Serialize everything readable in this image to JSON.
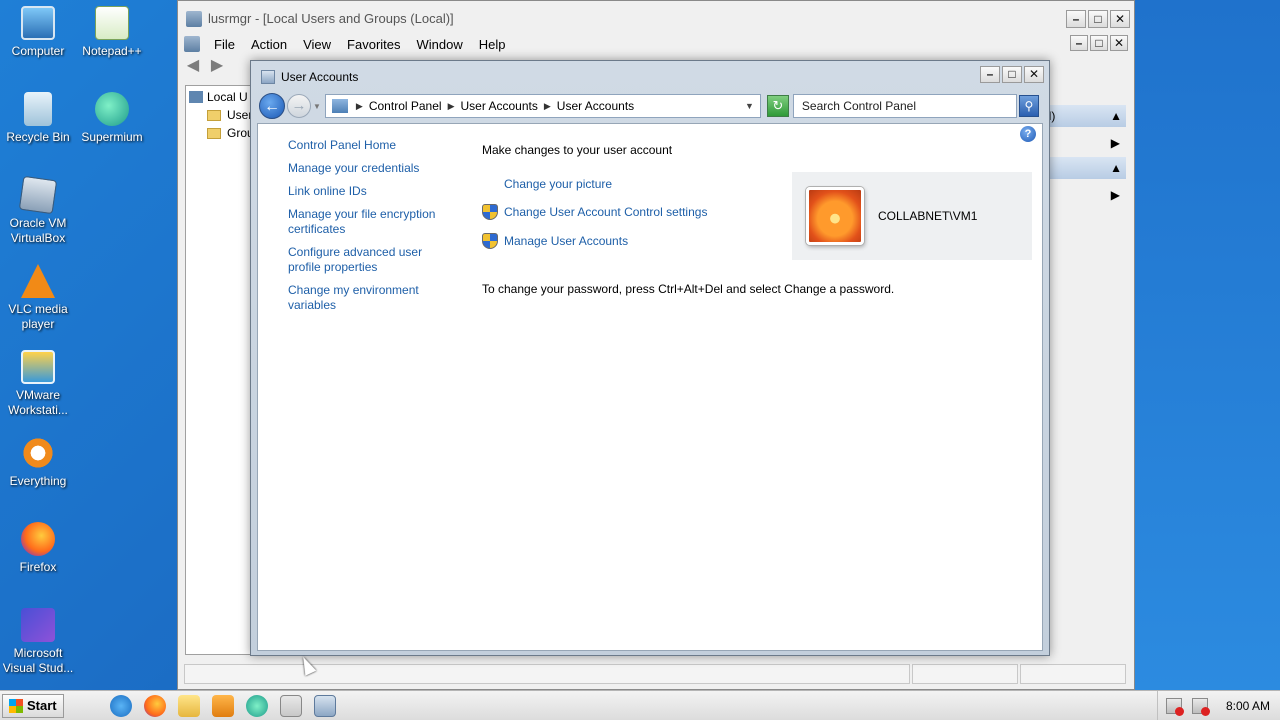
{
  "desktop": {
    "icons": [
      {
        "label": "Computer",
        "icon": "computer-icon"
      },
      {
        "label": "Notepad++",
        "icon": "notepadpp-icon"
      },
      {
        "label": "Recycle Bin",
        "icon": "recycle-bin-icon"
      },
      {
        "label": "Supermium",
        "icon": "supermium-icon"
      },
      {
        "label": "Oracle VM VirtualBox",
        "icon": "virtualbox-icon"
      },
      {
        "label": "VLC media player",
        "icon": "vlc-icon"
      },
      {
        "label": "VMware Workstati...",
        "icon": "vmware-icon"
      },
      {
        "label": "Everything",
        "icon": "everything-icon"
      },
      {
        "label": "Firefox",
        "icon": "firefox-icon"
      },
      {
        "label": "Microsoft Visual Stud...",
        "icon": "visual-studio-icon"
      }
    ]
  },
  "mmc": {
    "title": "lusrmgr - [Local Users and Groups (Local)]",
    "menu": [
      "File",
      "Action",
      "View",
      "Favorites",
      "Window",
      "Help"
    ],
    "tree": {
      "root": "Local U",
      "items": [
        "User",
        "Grou"
      ]
    },
    "actions_header_1": "al)",
    "controls": {
      "minimize": "–",
      "maximize": "□",
      "close": "✕"
    }
  },
  "user_accounts": {
    "title": "User Accounts",
    "breadcrumb": [
      "Control Panel",
      "User Accounts",
      "User Accounts"
    ],
    "search_placeholder": "Search Control Panel",
    "left_nav": {
      "home": "Control Panel Home",
      "links": [
        "Manage your credentials",
        "Link online IDs",
        "Manage your file encryption certificates",
        "Configure advanced user profile properties",
        "Change my environment variables"
      ]
    },
    "main": {
      "heading": "Make changes to your user account",
      "tasks": [
        {
          "label": "Change your picture",
          "shield": false
        },
        {
          "label": "Change User Account Control settings",
          "shield": true
        },
        {
          "label": "Manage User Accounts",
          "shield": true
        }
      ],
      "user_name": "COLLABNET\\VM1",
      "password_note": "To change your password, press Ctrl+Alt+Del and select Change a password."
    }
  },
  "taskbar": {
    "start_label": "Start",
    "pinned": [
      "internet-explorer-icon",
      "firefox-icon",
      "folder-icon",
      "media-player-icon",
      "supermium-icon",
      "lusrmgr-icon",
      "user-accounts-icon"
    ],
    "clock": "8:00 AM"
  }
}
